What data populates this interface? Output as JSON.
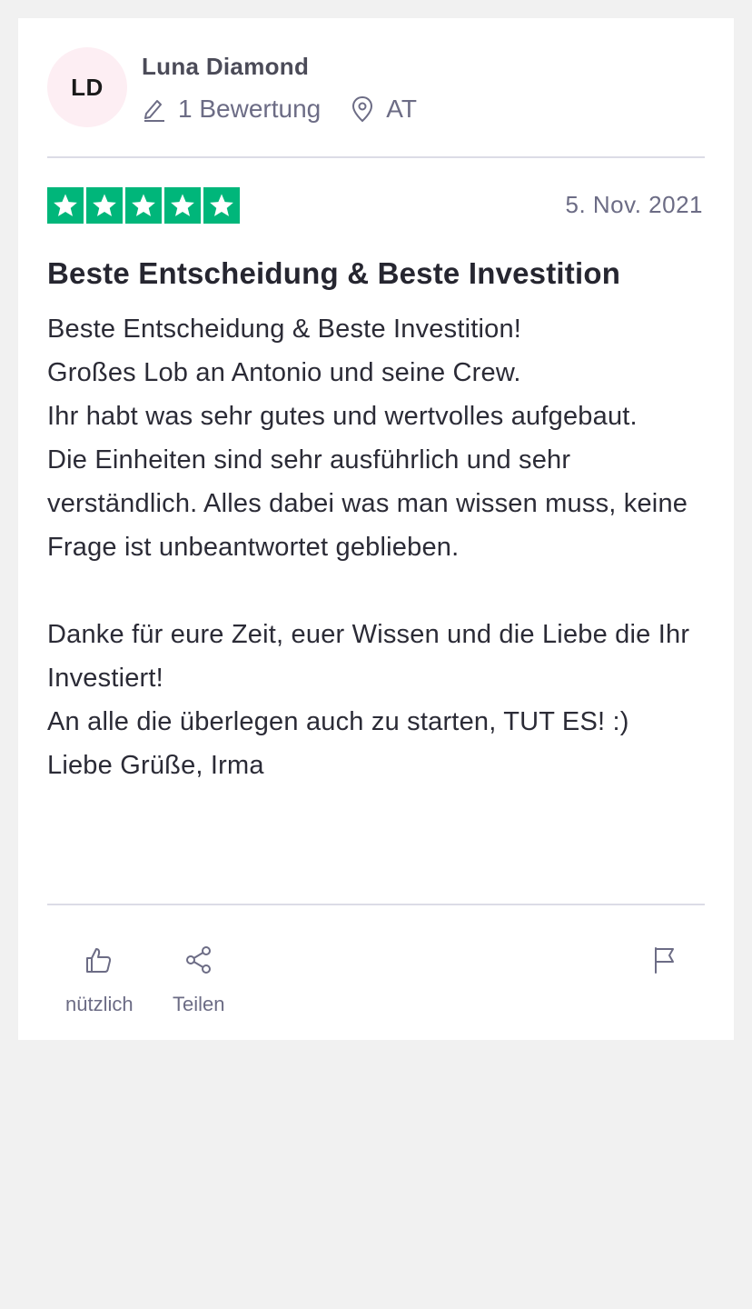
{
  "reviewer": {
    "initials": "LD",
    "name": "Luna Diamond",
    "review_count": "1 Bewertung",
    "country": "AT"
  },
  "review": {
    "rating": 5,
    "date": "5. Nov. 2021",
    "title": "Beste Entscheidung & Beste Investition",
    "lines": [
      "Beste Entscheidung & Beste Investition!",
      "Großes Lob an Antonio und seine Crew.",
      "Ihr habt was sehr gutes und wertvolles aufgebaut.",
      "Die Einheiten sind sehr ausführlich und sehr verständlich. Alles dabei was man wissen muss, keine Frage ist unbeantwortet geblieben.",
      "",
      "Danke für eure Zeit, euer Wissen und die Liebe die Ihr Investiert!",
      "An alle die überlegen auch zu starten, TUT ES! :)",
      "Liebe Grüße, Irma"
    ]
  },
  "actions": {
    "useful_label": "nützlich",
    "share_label": "Teilen"
  },
  "colors": {
    "star_green": "#00b67a",
    "avatar_bg": "#fdeef3"
  },
  "icons": {
    "review_count": "pencil-icon",
    "country": "location-pin-icon",
    "useful": "thumbs-up-icon",
    "share": "share-icon",
    "report": "flag-icon",
    "star": "star-icon"
  }
}
